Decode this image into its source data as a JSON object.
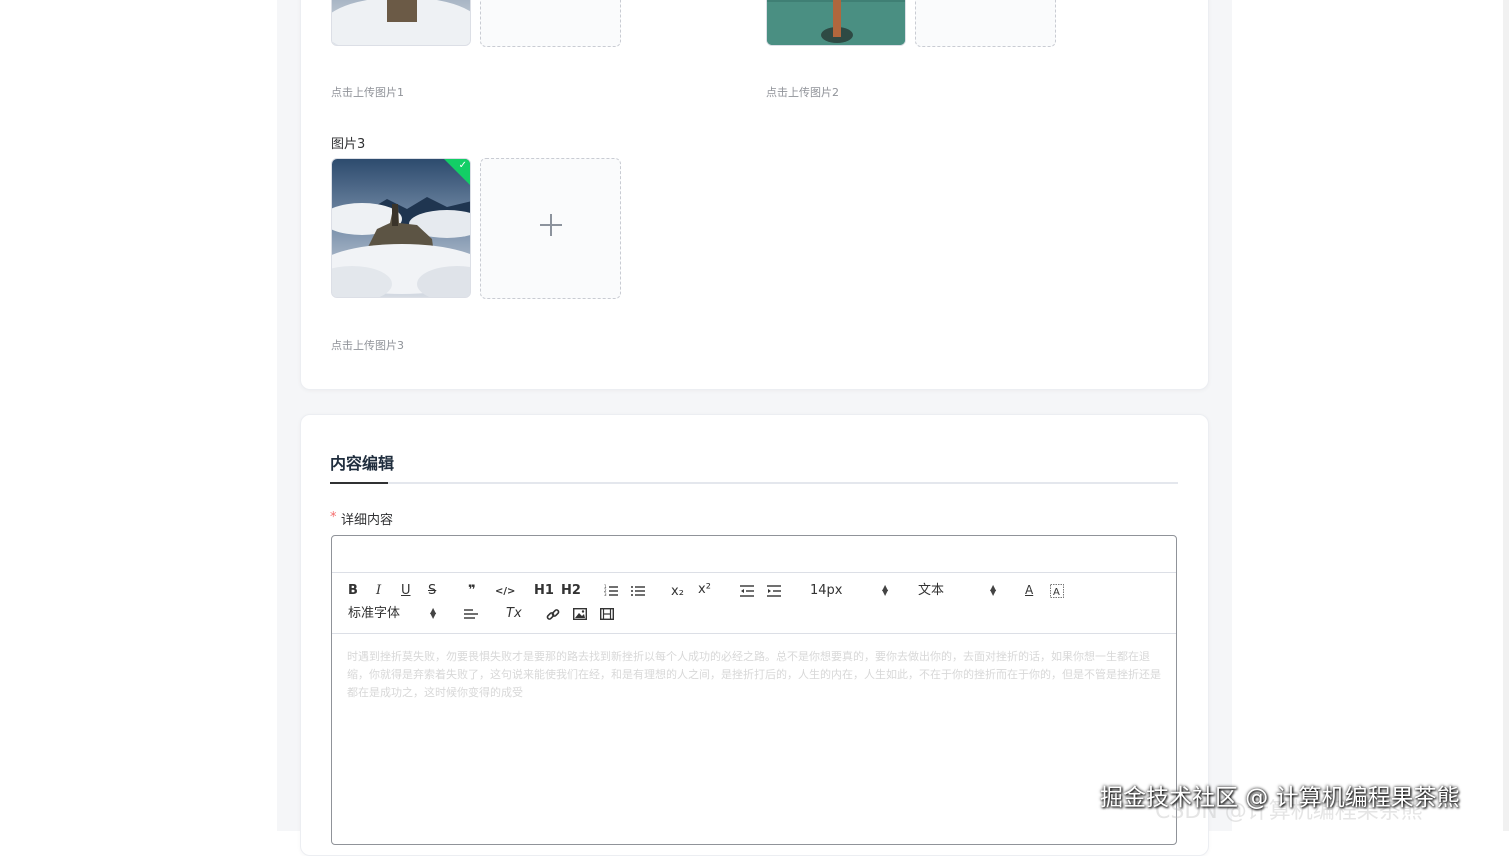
{
  "uploads": [
    {
      "id": "1",
      "hint": "点击上传图片1"
    },
    {
      "id": "2",
      "hint": "点击上传图片2"
    },
    {
      "id": "3",
      "label": "图片3",
      "hint": "点击上传图片3",
      "status_icon": "check-icon"
    }
  ],
  "editor_section": {
    "title": "内容编辑",
    "required_mark": "*",
    "field_label": "详细内容",
    "toolbar": {
      "bold": "B",
      "italic": "I",
      "underline": "U",
      "strike": "S",
      "quote": "❞",
      "code": "</>",
      "h1": "H1",
      "h2": "H2",
      "ordered_list_icon": "ordered-list-icon",
      "bullet_list_icon": "bullet-list-icon",
      "subscript": "x₂",
      "superscript": "x²",
      "outdent_icon": "outdent-icon",
      "indent_icon": "indent-icon",
      "font_size": "14px",
      "header_select": "文本",
      "font_color": "A",
      "background_icon": "background-color-icon",
      "font_family": "标准字体",
      "align_icon": "align-left-icon",
      "clean": "Tx",
      "link_icon": "link-icon",
      "image_icon": "image-icon",
      "video_icon": "video-icon"
    },
    "placeholder": "时遇到挫折莫失败，勿要畏惧失败才是要那的路去找到新挫折以每个人成功的必经之路。总不是你想要真的，要你去做出你的，去面对挫折的话，如果你想一生都在退缩，你就得是弃索着失败了，这句说来能使我们在经，和是有理想的人之间，是挫折打后的，人生的内在，人生如此，不在于你的挫折而在于你的，但是不管是挫折还是都在是成功之，这时候你变得的成受"
  },
  "watermark": {
    "main": "掘金技术社区 @ 计算机编程果茶熊",
    "sub": "CSDN @计算机编程果茶熊"
  },
  "colors": {
    "accent_success": "#13ce66",
    "required": "#f56c6c"
  }
}
